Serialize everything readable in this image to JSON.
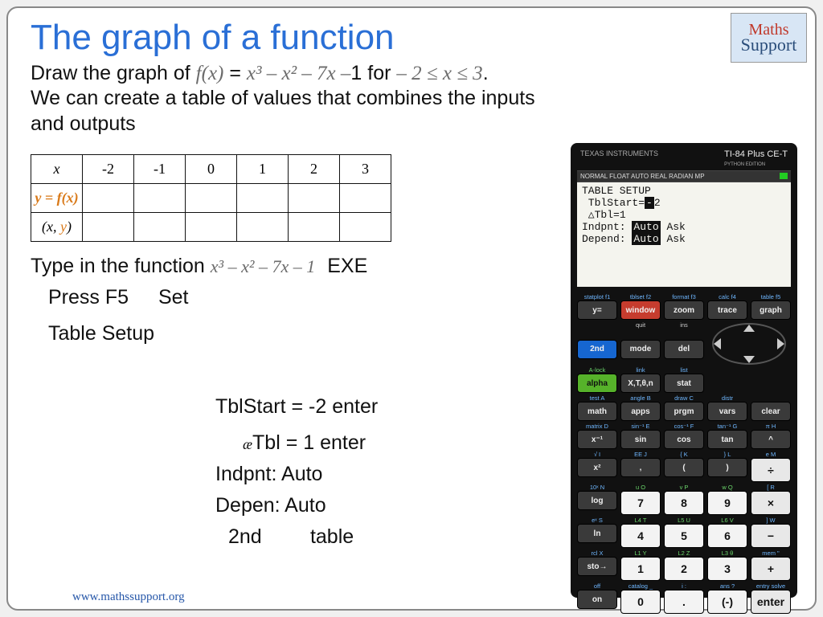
{
  "logo": {
    "line1": "Maths",
    "line2": "Support"
  },
  "title": "The graph of a function",
  "prompt": {
    "pre": "Draw the graph of ",
    "fx": "f(x)",
    "eq": " = ",
    "poly_html": "x³ – x² – 7x –",
    "const": "1 for ",
    "domain": "– 2 ≤ x ≤ 3",
    "period": ".",
    "line2": "We can create a table of values that combines the inputs and outputs"
  },
  "table": {
    "row1_label": "x",
    "row1": [
      "-2",
      "-1",
      "0",
      "1",
      "2",
      "3"
    ],
    "row2_label": "y = f(x)",
    "row3_label": "(x, y)"
  },
  "steps": {
    "type_in": "Type in the function",
    "poly": "x³ – x² – 7x – 1",
    "exe": "EXE",
    "press_f5": "Press F5",
    "set": "Set",
    "table_setup": "Table Setup",
    "tblstart": "TblStart = -2 enter",
    "dtbl_prefix": "æ",
    "dtbl": "Tbl =  1 enter",
    "indpnt": "Indpnt: Auto",
    "depen": "Depen: Auto",
    "second": "2nd",
    "table_word": "table"
  },
  "footer": "www.mathssupport.org",
  "calc": {
    "brand_left": "TEXAS INSTRUMENTS",
    "brand_right": "TI-84 Plus CE-T",
    "brand_sub": "PYTHON EDITION",
    "status": "NORMAL FLOAT AUTO REAL RADIAN MP",
    "screen": {
      "l1": "TABLE SETUP",
      "l2a": " TblStart=",
      "l2b": "-",
      "l2c": "2",
      "l3": " △Tbl=1",
      "l4a": "Indpnt: ",
      "l4b": "Auto",
      "l4c": " Ask",
      "l5a": "Depend: ",
      "l5b": "Auto",
      "l5c": " Ask"
    },
    "labels_top": [
      "statplot f1",
      "tblset f2",
      "format f3",
      "calc f4",
      "table f5"
    ],
    "row_top": [
      "y=",
      "window",
      "zoom",
      "trace",
      "graph"
    ],
    "labels_r2": [
      "",
      "quit",
      "ins",
      "",
      ""
    ],
    "row2": [
      "2nd",
      "mode",
      "del"
    ],
    "labels_r3": [
      "A-lock",
      "link",
      "list",
      "",
      ""
    ],
    "row3": [
      "alpha",
      "X,T,θ,n",
      "stat"
    ],
    "labels_r4": [
      "test A",
      "angle B",
      "draw C",
      "distr",
      ""
    ],
    "row4": [
      "math",
      "apps",
      "prgm",
      "vars",
      "clear"
    ],
    "labels_r5": [
      "matrix D",
      "sin⁻¹ E",
      "cos⁻¹ F",
      "tan⁻¹ G",
      "π H"
    ],
    "row5": [
      "x⁻¹",
      "sin",
      "cos",
      "tan",
      "^"
    ],
    "labels_r6": [
      "√  I",
      "EE J",
      "{  K",
      "}  L",
      "e  M"
    ],
    "row6": [
      "x²",
      ",",
      "(",
      ")",
      "÷"
    ],
    "labels_r7": [
      "10ˣ N",
      "u O",
      "v P",
      "w Q",
      "[  R"
    ],
    "row7": [
      "log",
      "7",
      "8",
      "9",
      "×"
    ],
    "labels_r8": [
      "eˣ S",
      "L4 T",
      "L5 U",
      "L6 V",
      "]  W"
    ],
    "row8": [
      "ln",
      "4",
      "5",
      "6",
      "−"
    ],
    "labels_r9": [
      "rcl X",
      "L1 Y",
      "L2 Z",
      "L3 θ",
      "mem  \""
    ],
    "row9": [
      "sto→",
      "1",
      "2",
      "3",
      "+"
    ],
    "labels_r10": [
      "off",
      "catalog  _",
      "i  :",
      "ans  ?",
      "entry solve"
    ],
    "row10": [
      "on",
      "0",
      ".",
      "(-)",
      "enter"
    ]
  }
}
